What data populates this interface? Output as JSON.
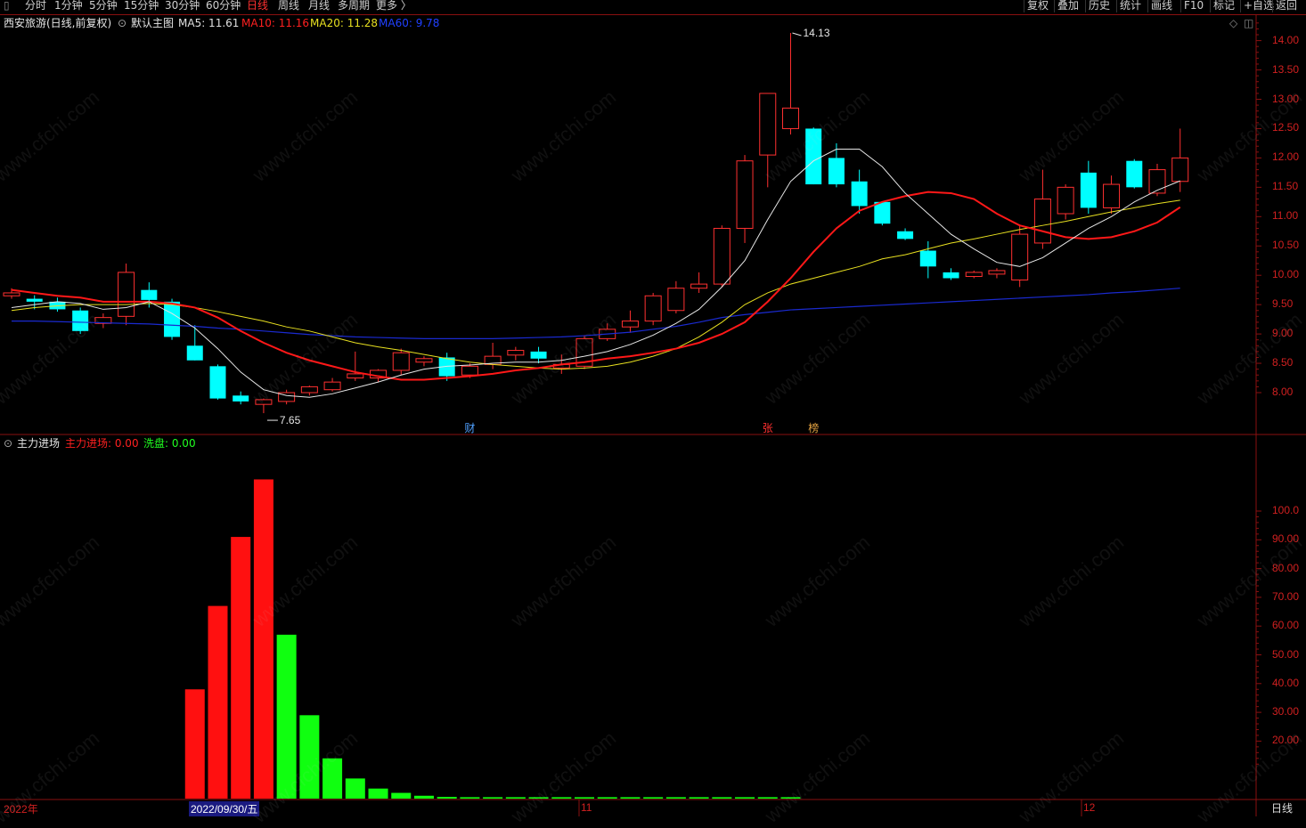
{
  "toolbar": {
    "left": [
      {
        "label": "分时",
        "active": false
      },
      {
        "label": "1分钟",
        "active": false
      },
      {
        "label": "5分钟",
        "active": false
      },
      {
        "label": "15分钟",
        "active": false
      },
      {
        "label": "30分钟",
        "active": false
      },
      {
        "label": "60分钟",
        "active": false
      },
      {
        "label": "日线",
        "active": true
      },
      {
        "label": "周线",
        "active": false
      },
      {
        "label": "月线",
        "active": false
      },
      {
        "label": "多周期",
        "active": false
      },
      {
        "label": "更多 〉",
        "active": false
      }
    ],
    "right": [
      "复权",
      "叠加",
      "历史",
      "统计",
      "画线",
      "F10",
      "标记",
      "+自选",
      "返回"
    ]
  },
  "main_panel": {
    "title": "西安旅游(日线,前复权)",
    "template": "默认主图",
    "ma": [
      {
        "label": "MA5: 11.61",
        "color": "#e0e0e0"
      },
      {
        "label": "MA10: 11.16",
        "color": "#ff2020"
      },
      {
        "label": "MA20: 11.28",
        "color": "#e8e020"
      },
      {
        "label": "MA60: 9.78",
        "color": "#2040ff"
      }
    ],
    "high_label": "14.13",
    "low_label": "7.65",
    "markers": [
      {
        "label": "财",
        "color": "#4fa0ff"
      },
      {
        "label": "张",
        "color": "#ff3030"
      },
      {
        "label": "榜",
        "color": "#e0a040"
      }
    ]
  },
  "sub_panel": {
    "title": "主力进场",
    "values": [
      {
        "label": "主力进场: 0.00",
        "color": "#ff2020"
      },
      {
        "label": "洗盘: 0.00",
        "color": "#20ff20"
      }
    ]
  },
  "price_axis": [
    "14.00",
    "13.50",
    "13.00",
    "12.50",
    "12.00",
    "11.50",
    "11.00",
    "10.50",
    "10.00",
    "9.50",
    "9.00",
    "8.50",
    "8.00"
  ],
  "sub_axis": [
    "100.0",
    "90.00",
    "80.00",
    "70.00",
    "60.00",
    "50.00",
    "40.00",
    "30.00",
    "20.00"
  ],
  "date_axis": [
    {
      "label": "2022年",
      "color": "#d02020",
      "highlight": false
    },
    {
      "label": "2022/09/30/五",
      "color": "#ffffff",
      "highlight": true
    },
    {
      "label": "11",
      "color": "#d02020",
      "highlight": false
    },
    {
      "label": "12",
      "color": "#d02020",
      "highlight": false
    }
  ],
  "period_label": "日线",
  "watermark": "www.cfchi.com",
  "chart_data": {
    "type": "candlestick",
    "ohlc": [
      [
        9.65,
        9.78,
        9.6,
        9.7
      ],
      [
        9.6,
        9.66,
        9.42,
        9.55
      ],
      [
        9.55,
        9.62,
        9.38,
        9.42
      ],
      [
        9.4,
        9.45,
        9.0,
        9.05
      ],
      [
        9.18,
        9.35,
        9.1,
        9.28
      ],
      [
        9.3,
        10.2,
        9.15,
        10.05
      ],
      [
        9.75,
        9.88,
        9.45,
        9.58
      ],
      [
        9.55,
        9.6,
        8.9,
        8.95
      ],
      [
        8.8,
        9.15,
        8.55,
        8.55
      ],
      [
        8.45,
        8.48,
        7.88,
        7.9
      ],
      [
        7.95,
        8.02,
        7.8,
        7.85
      ],
      [
        7.8,
        7.9,
        7.65,
        7.88
      ],
      [
        7.85,
        8.05,
        7.8,
        8.0
      ],
      [
        8.0,
        8.12,
        7.95,
        8.1
      ],
      [
        8.05,
        8.25,
        8.02,
        8.18
      ],
      [
        8.25,
        8.7,
        8.2,
        8.32
      ],
      [
        8.25,
        8.4,
        8.18,
        8.38
      ],
      [
        8.38,
        8.75,
        8.3,
        8.68
      ],
      [
        8.52,
        8.62,
        8.45,
        8.58
      ],
      [
        8.6,
        8.68,
        8.2,
        8.28
      ],
      [
        8.3,
        8.5,
        8.25,
        8.45
      ],
      [
        8.48,
        8.85,
        8.4,
        8.62
      ],
      [
        8.64,
        8.78,
        8.55,
        8.72
      ],
      [
        8.7,
        8.78,
        8.5,
        8.58
      ],
      [
        8.42,
        8.65,
        8.32,
        8.48
      ],
      [
        8.45,
        8.98,
        8.4,
        8.92
      ],
      [
        8.92,
        9.18,
        8.88,
        9.08
      ],
      [
        9.12,
        9.4,
        9.02,
        9.22
      ],
      [
        9.22,
        9.7,
        9.15,
        9.65
      ],
      [
        9.4,
        9.9,
        9.35,
        9.78
      ],
      [
        9.78,
        10.05,
        9.7,
        9.85
      ],
      [
        9.85,
        10.85,
        9.8,
        10.8
      ],
      [
        10.8,
        12.05,
        10.55,
        11.95
      ],
      [
        12.05,
        13.1,
        11.5,
        13.1
      ],
      [
        12.5,
        14.13,
        12.4,
        12.85
      ],
      [
        12.5,
        12.52,
        11.55,
        11.55
      ],
      [
        12.0,
        12.25,
        11.5,
        11.55
      ],
      [
        11.6,
        11.8,
        11.05,
        11.18
      ],
      [
        11.25,
        11.25,
        10.85,
        10.88
      ],
      [
        10.75,
        10.8,
        10.6,
        10.62
      ],
      [
        10.42,
        10.58,
        9.95,
        10.15
      ],
      [
        10.05,
        10.12,
        9.92,
        9.95
      ],
      [
        9.98,
        10.08,
        9.95,
        10.05
      ],
      [
        10.02,
        10.12,
        9.95,
        10.08
      ],
      [
        9.92,
        10.85,
        9.8,
        10.7
      ],
      [
        10.55,
        11.8,
        10.45,
        11.3
      ],
      [
        11.05,
        11.55,
        10.95,
        11.5
      ],
      [
        11.75,
        11.95,
        11.05,
        11.15
      ],
      [
        11.15,
        11.7,
        11.05,
        11.55
      ],
      [
        11.95,
        11.98,
        11.48,
        11.5
      ],
      [
        11.4,
        11.9,
        11.35,
        11.8
      ],
      [
        11.6,
        12.5,
        11.42,
        12.0
      ]
    ],
    "ma5": [
      9.45,
      9.5,
      9.55,
      9.52,
      9.42,
      9.45,
      9.55,
      9.35,
      9.1,
      8.75,
      8.35,
      8.05,
      7.95,
      7.92,
      7.98,
      8.08,
      8.18,
      8.3,
      8.4,
      8.45,
      8.47,
      8.5,
      8.52,
      8.52,
      8.55,
      8.62,
      8.7,
      8.82,
      8.98,
      9.18,
      9.42,
      9.8,
      10.25,
      10.95,
      11.6,
      11.95,
      12.15,
      12.15,
      11.85,
      11.4,
      11.05,
      10.7,
      10.45,
      10.22,
      10.15,
      10.3,
      10.55,
      10.8,
      11.0,
      11.25,
      11.45,
      11.61
    ],
    "ma10": [
      9.75,
      9.7,
      9.65,
      9.62,
      9.55,
      9.55,
      9.55,
      9.52,
      9.45,
      9.28,
      9.05,
      8.85,
      8.68,
      8.55,
      8.45,
      8.35,
      8.28,
      8.22,
      8.22,
      8.25,
      8.28,
      8.32,
      8.38,
      8.42,
      8.48,
      8.52,
      8.58,
      8.62,
      8.68,
      8.75,
      8.85,
      9.0,
      9.2,
      9.55,
      9.95,
      10.4,
      10.8,
      11.1,
      11.25,
      11.35,
      11.42,
      11.4,
      11.3,
      11.05,
      10.85,
      10.75,
      10.65,
      10.62,
      10.65,
      10.75,
      10.9,
      11.16
    ],
    "ma20": [
      9.4,
      9.45,
      9.48,
      9.5,
      9.5,
      9.5,
      9.52,
      9.5,
      9.45,
      9.38,
      9.3,
      9.22,
      9.12,
      9.05,
      8.95,
      8.85,
      8.78,
      8.72,
      8.65,
      8.58,
      8.52,
      8.48,
      8.45,
      8.42,
      8.4,
      8.42,
      8.45,
      8.52,
      8.62,
      8.75,
      8.95,
      9.2,
      9.5,
      9.7,
      9.85,
      9.95,
      10.05,
      10.15,
      10.28,
      10.35,
      10.45,
      10.55,
      10.62,
      10.7,
      10.78,
      10.85,
      10.92,
      11.0,
      11.08,
      11.15,
      11.22,
      11.28
    ],
    "ma60": [
      9.22,
      9.22,
      9.21,
      9.2,
      9.19,
      9.18,
      9.17,
      9.15,
      9.13,
      9.1,
      9.08,
      9.05,
      9.02,
      8.99,
      8.97,
      8.95,
      8.94,
      8.93,
      8.92,
      8.92,
      8.92,
      8.92,
      8.93,
      8.94,
      8.95,
      8.97,
      9.0,
      9.03,
      9.08,
      9.13,
      9.2,
      9.28,
      9.33,
      9.37,
      9.41,
      9.43,
      9.45,
      9.47,
      9.49,
      9.51,
      9.53,
      9.55,
      9.57,
      9.59,
      9.61,
      9.63,
      9.65,
      9.67,
      9.7,
      9.72,
      9.75,
      9.78
    ],
    "sub_type": "bar",
    "sub_series": [
      {
        "name": "主力进场",
        "values": [
          0,
          0,
          0,
          0,
          0,
          0,
          0,
          0,
          38,
          67,
          91,
          111,
          0,
          0,
          0,
          0,
          0,
          0,
          0,
          0,
          0,
          0,
          0,
          0,
          0,
          0,
          0,
          0,
          0,
          0,
          0,
          0,
          0,
          0,
          0,
          0,
          0,
          0,
          0,
          0,
          0,
          0,
          0,
          0,
          0,
          0,
          0,
          0,
          0,
          0,
          0,
          0
        ]
      },
      {
        "name": "洗盘",
        "values": [
          0,
          0,
          0,
          0,
          0,
          0,
          0,
          0,
          0,
          0,
          0,
          0,
          57,
          29,
          14,
          7,
          3.5,
          2,
          1,
          0.6,
          0.5,
          0.5,
          0.5,
          0.5,
          0.5,
          0.5,
          0.5,
          0.5,
          0.5,
          0.5,
          0.5,
          0.5,
          0.5,
          0.5,
          0.5,
          0,
          0,
          0,
          0,
          0,
          0,
          0,
          0,
          0,
          0,
          0,
          0,
          0,
          0,
          0,
          0,
          0
        ]
      }
    ],
    "ylim_main": [
      7.4,
      14.3
    ],
    "ylim_sub": [
      0,
      120
    ]
  }
}
